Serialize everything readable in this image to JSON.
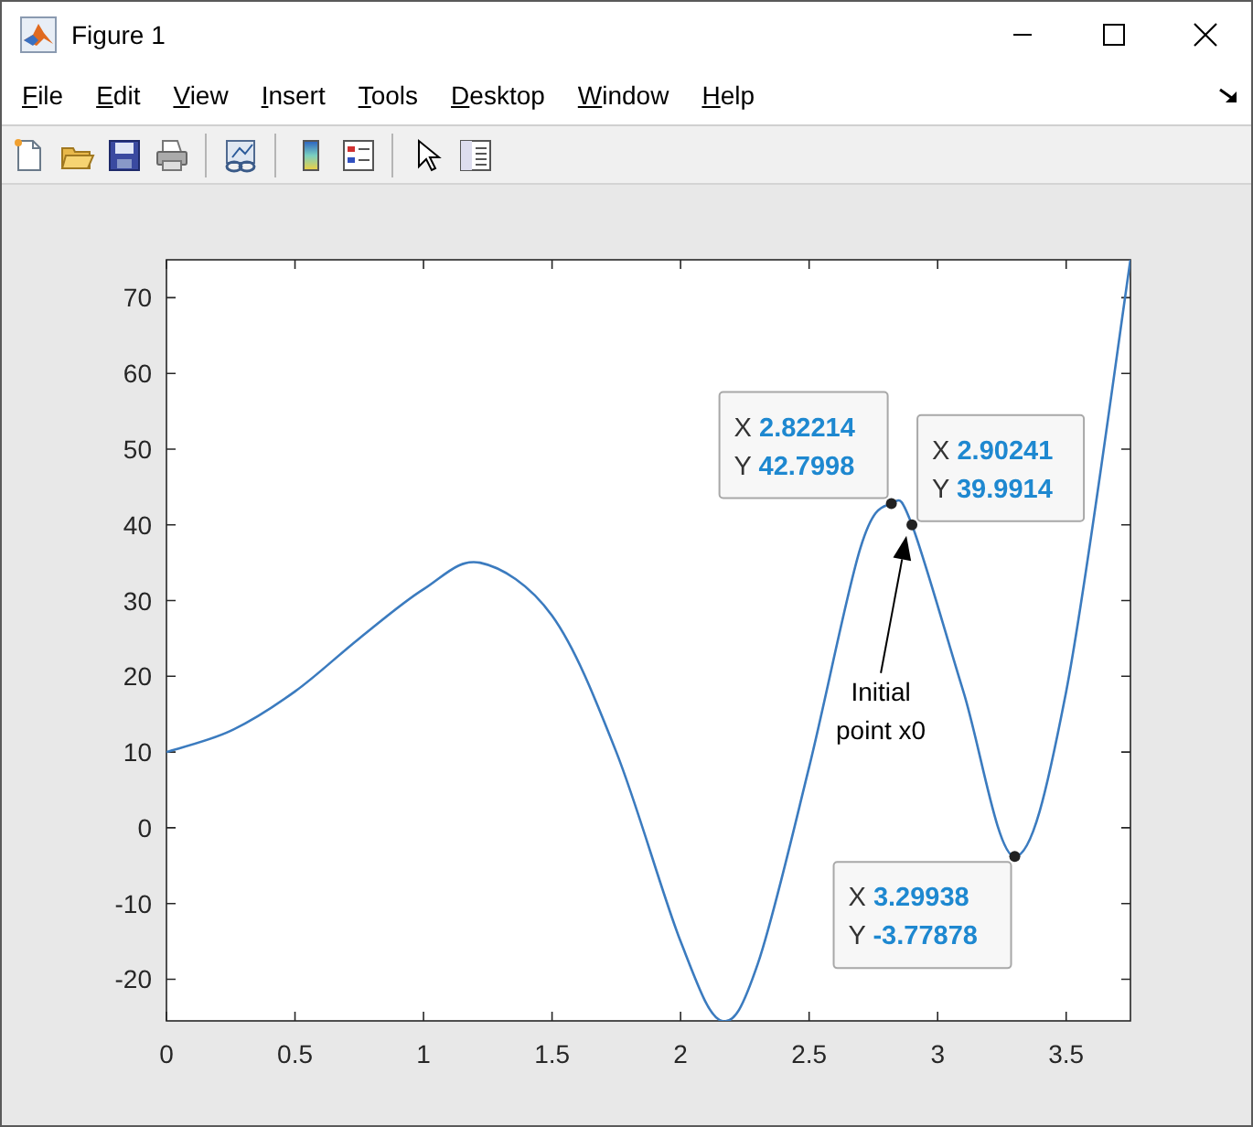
{
  "window": {
    "title": "Figure 1"
  },
  "menu": [
    {
      "label": "File"
    },
    {
      "label": "Edit"
    },
    {
      "label": "View"
    },
    {
      "label": "Insert"
    },
    {
      "label": "Tools"
    },
    {
      "label": "Desktop"
    },
    {
      "label": "Window"
    },
    {
      "label": "Help"
    }
  ],
  "toolbar": [
    {
      "kind": "new"
    },
    {
      "kind": "open"
    },
    {
      "kind": "save"
    },
    {
      "kind": "print"
    },
    {
      "kind": "separator"
    },
    {
      "kind": "link"
    },
    {
      "kind": "separator"
    },
    {
      "kind": "colorbar"
    },
    {
      "kind": "legend"
    },
    {
      "kind": "separator"
    },
    {
      "kind": "pointer"
    },
    {
      "kind": "inspector"
    }
  ],
  "axes": {
    "chart_data": {
      "type": "line",
      "xlim": [
        0,
        3.75
      ],
      "ylim": [
        -25.5,
        75
      ],
      "xticks": [
        0,
        0.5,
        1,
        1.5,
        2,
        2.5,
        3,
        3.5
      ],
      "yticks": [
        -20,
        -10,
        0,
        10,
        20,
        30,
        40,
        50,
        60,
        70
      ],
      "series": [
        {
          "color": "#3b7bbf",
          "x": [
            0,
            0.25,
            0.5,
            0.75,
            1,
            1.22,
            1.5,
            1.75,
            2,
            2.16,
            2.3,
            2.5,
            2.7,
            2.82,
            2.9,
            3.1,
            3.3,
            3.5,
            3.75
          ],
          "values": [
            10,
            12.8,
            18,
            25,
            31.5,
            35,
            28,
            10,
            -15,
            -25.5,
            -18,
            8,
            37,
            42.8,
            40,
            18,
            -3.8,
            18,
            75
          ]
        }
      ],
      "annotations": [
        {
          "text": "Initial point x0"
        }
      ]
    },
    "datatips": [
      {
        "x_name": "X",
        "x_label": "2.82214",
        "y_name": "Y",
        "y_label": "42.7998"
      },
      {
        "x_name": "X",
        "x_label": "2.90241",
        "y_name": "Y",
        "y_label": "39.9914"
      },
      {
        "x_name": "X",
        "x_label": "3.29938",
        "y_name": "Y",
        "y_label": "-3.77878"
      }
    ]
  }
}
